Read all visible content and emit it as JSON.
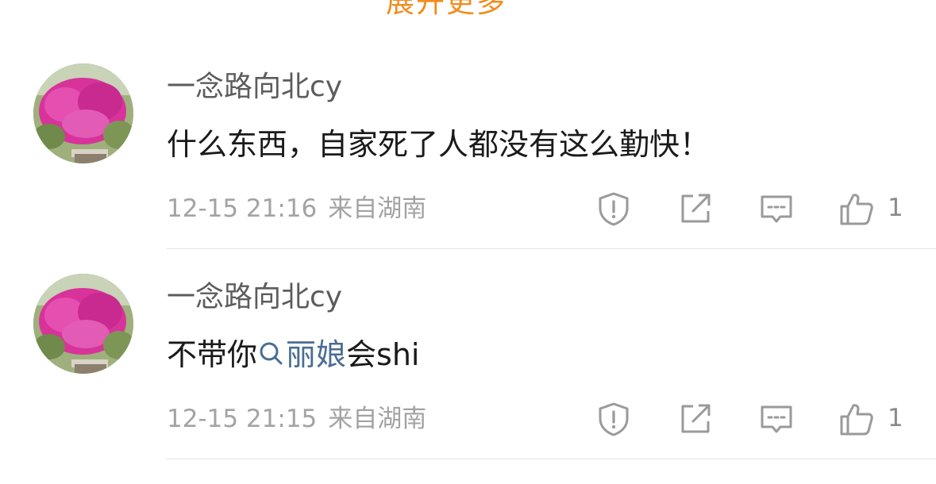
{
  "header": {
    "expand_more_label": "展开更多"
  },
  "comments": [
    {
      "username": "一念路向北cy",
      "content_plain": "什么东西，自家死了人都没有这么勤快！",
      "timestamp": "12-15 21:16",
      "location": "来自湖南",
      "like_count": "1",
      "actions": [
        "report-icon",
        "share-icon",
        "reply-icon",
        "like-icon"
      ]
    },
    {
      "username": "一念路向北cy",
      "content_prefix": "不带你",
      "content_topic": "丽娘",
      "content_suffix": "会shi",
      "timestamp": "12-15 21:15",
      "location": "来自湖南",
      "like_count": "1",
      "actions": [
        "report-icon",
        "share-icon",
        "reply-icon",
        "like-icon"
      ]
    }
  ],
  "colors": {
    "accent_orange": "#f28c1b",
    "link_blue": "#4a6d93",
    "text_primary": "#1a1a1a",
    "text_secondary": "#5c5c5c",
    "text_meta": "#a3a3a3"
  }
}
